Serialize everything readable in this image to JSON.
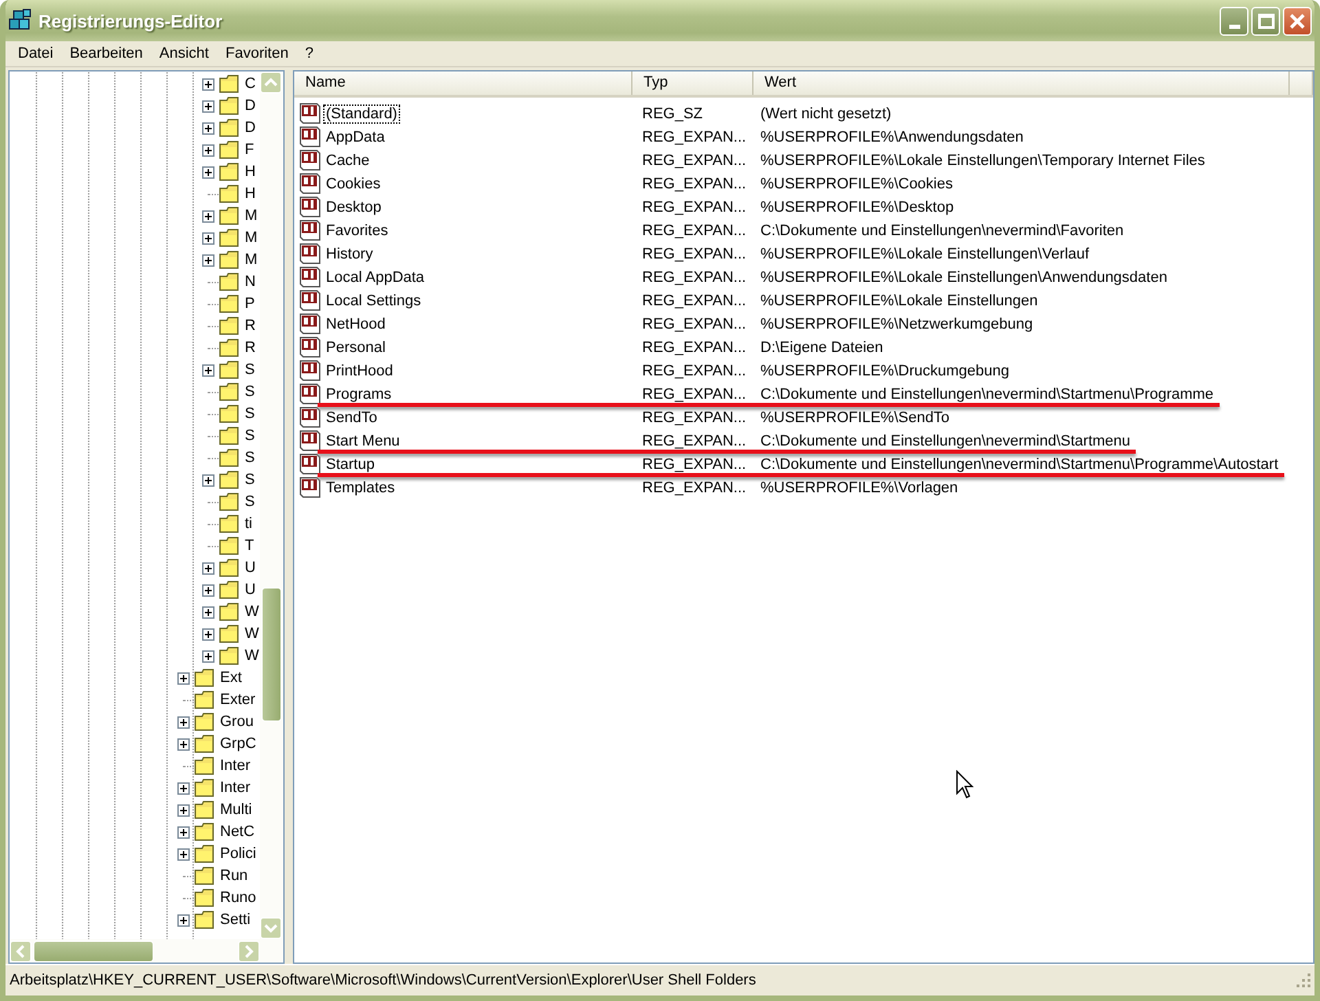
{
  "window": {
    "title": "Registrierungs-Editor"
  },
  "menu": [
    "Datei",
    "Bearbeiten",
    "Ansicht",
    "Favoriten",
    "?"
  ],
  "tree": {
    "items": [
      {
        "label": "C",
        "expandable": true
      },
      {
        "label": "D",
        "expandable": true
      },
      {
        "label": "D",
        "expandable": true
      },
      {
        "label": "F",
        "expandable": true
      },
      {
        "label": "H",
        "expandable": true
      },
      {
        "label": "H",
        "expandable": false
      },
      {
        "label": "M",
        "expandable": true
      },
      {
        "label": "M",
        "expandable": true
      },
      {
        "label": "M",
        "expandable": true
      },
      {
        "label": "N",
        "expandable": false
      },
      {
        "label": "P",
        "expandable": false
      },
      {
        "label": "R",
        "expandable": false
      },
      {
        "label": "R",
        "expandable": false
      },
      {
        "label": "S",
        "expandable": true
      },
      {
        "label": "S",
        "expandable": false
      },
      {
        "label": "S",
        "expandable": false
      },
      {
        "label": "S",
        "expandable": false
      },
      {
        "label": "S",
        "expandable": false
      },
      {
        "label": "S",
        "expandable": true
      },
      {
        "label": "S",
        "expandable": false
      },
      {
        "label": "ti",
        "expandable": false
      },
      {
        "label": "T",
        "expandable": false
      },
      {
        "label": "U",
        "expandable": true
      },
      {
        "label": "U",
        "expandable": true
      },
      {
        "label": "W",
        "expandable": true
      },
      {
        "label": "W",
        "expandable": true
      },
      {
        "label": "W",
        "expandable": true
      }
    ],
    "siblings": [
      {
        "label": "Ext",
        "expandable": true
      },
      {
        "label": "Exter",
        "expandable": false
      },
      {
        "label": "Grou",
        "expandable": true
      },
      {
        "label": "GrpC",
        "expandable": true
      },
      {
        "label": "Inter",
        "expandable": false
      },
      {
        "label": "Inter",
        "expandable": true
      },
      {
        "label": "Multi",
        "expandable": true
      },
      {
        "label": "NetC",
        "expandable": true
      },
      {
        "label": "Polici",
        "expandable": true
      },
      {
        "label": "Run",
        "expandable": false
      },
      {
        "label": "Runo",
        "expandable": false
      },
      {
        "label": "Setti",
        "expandable": true
      }
    ]
  },
  "table": {
    "columns": [
      "Name",
      "Typ",
      "Wert"
    ],
    "rows": [
      {
        "name": "(Standard)",
        "type": "REG_SZ",
        "value": "(Wert nicht gesetzt)",
        "selected": true,
        "underlined": false
      },
      {
        "name": "AppData",
        "type": "REG_EXPAN...",
        "value": "%USERPROFILE%\\Anwendungsdaten",
        "selected": false,
        "underlined": false
      },
      {
        "name": "Cache",
        "type": "REG_EXPAN...",
        "value": "%USERPROFILE%\\Lokale Einstellungen\\Temporary Internet Files",
        "selected": false,
        "underlined": false
      },
      {
        "name": "Cookies",
        "type": "REG_EXPAN...",
        "value": "%USERPROFILE%\\Cookies",
        "selected": false,
        "underlined": false
      },
      {
        "name": "Desktop",
        "type": "REG_EXPAN...",
        "value": "%USERPROFILE%\\Desktop",
        "selected": false,
        "underlined": false
      },
      {
        "name": "Favorites",
        "type": "REG_EXPAN...",
        "value": "C:\\Dokumente und Einstellungen\\nevermind\\Favoriten",
        "selected": false,
        "underlined": false
      },
      {
        "name": "History",
        "type": "REG_EXPAN...",
        "value": "%USERPROFILE%\\Lokale Einstellungen\\Verlauf",
        "selected": false,
        "underlined": false
      },
      {
        "name": "Local AppData",
        "type": "REG_EXPAN...",
        "value": "%USERPROFILE%\\Lokale Einstellungen\\Anwendungsdaten",
        "selected": false,
        "underlined": false
      },
      {
        "name": "Local Settings",
        "type": "REG_EXPAN...",
        "value": "%USERPROFILE%\\Lokale Einstellungen",
        "selected": false,
        "underlined": false
      },
      {
        "name": "NetHood",
        "type": "REG_EXPAN...",
        "value": "%USERPROFILE%\\Netzwerkumgebung",
        "selected": false,
        "underlined": false
      },
      {
        "name": "Personal",
        "type": "REG_EXPAN...",
        "value": "D:\\Eigene Dateien",
        "selected": false,
        "underlined": false
      },
      {
        "name": "PrintHood",
        "type": "REG_EXPAN...",
        "value": "%USERPROFILE%\\Druckumgebung",
        "selected": false,
        "underlined": false
      },
      {
        "name": "Programs",
        "type": "REG_EXPAN...",
        "value": "C:\\Dokumente und Einstellungen\\nevermind\\Startmenu\\Programme",
        "selected": false,
        "underlined": true
      },
      {
        "name": "SendTo",
        "type": "REG_EXPAN...",
        "value": "%USERPROFILE%\\SendTo",
        "selected": false,
        "underlined": false
      },
      {
        "name": "Start Menu",
        "type": "REG_EXPAN...",
        "value": "C:\\Dokumente und Einstellungen\\nevermind\\Startmenu",
        "selected": false,
        "underlined": true
      },
      {
        "name": "Startup",
        "type": "REG_EXPAN...",
        "value": "C:\\Dokumente und Einstellungen\\nevermind\\Startmenu\\Programme\\Autostart",
        "selected": false,
        "underlined": true
      },
      {
        "name": "Templates",
        "type": "REG_EXPAN...",
        "value": "%USERPROFILE%\\Vorlagen",
        "selected": false,
        "underlined": false
      }
    ]
  },
  "status_bar": "Arbeitsplatz\\HKEY_CURRENT_USER\\Software\\Microsoft\\Windows\\CurrentVersion\\Explorer\\User Shell Folders"
}
